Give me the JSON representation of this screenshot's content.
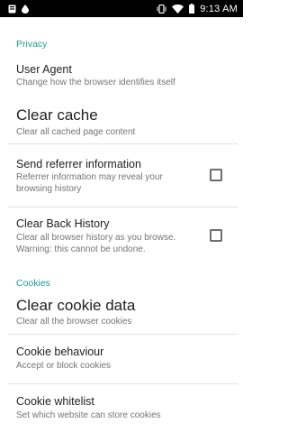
{
  "status_bar": {
    "time": "9:13 AM",
    "left_icons": [
      "app-notification-icon",
      "droplet-icon"
    ],
    "right_icons": [
      "vibrate-icon",
      "wifi-icon",
      "battery-icon"
    ]
  },
  "sections": {
    "privacy": {
      "header": "Privacy",
      "items": {
        "user_agent": {
          "title": "User Agent",
          "summary": "Change how the browser identifies itself"
        },
        "clear_cache": {
          "title": "Clear cache",
          "summary": "Clear all cached page content"
        },
        "send_referrer": {
          "title": "Send referrer information",
          "summary": "Referrer information may reveal your\nbrowsing history",
          "checked": false
        },
        "clear_back_history": {
          "title": "Clear Back History",
          "summary": "Clear all browser history as you browse.\nWarning: this cannot be undone.",
          "checked": false
        }
      }
    },
    "cookies": {
      "header": "Cookies",
      "items": {
        "clear_cookie_data": {
          "title": "Clear cookie data",
          "summary": "Clear all the browser cookies"
        },
        "cookie_behaviour": {
          "title": "Cookie behaviour",
          "summary": "Accept or block cookies"
        },
        "cookie_whitelist": {
          "title": "Cookie whitelist",
          "summary": "Set which website can store cookies"
        }
      }
    }
  },
  "colors": {
    "accent": "#1e9e90",
    "status_bar": "#000000",
    "title_text": "#212121",
    "summary_text": "#757575"
  }
}
